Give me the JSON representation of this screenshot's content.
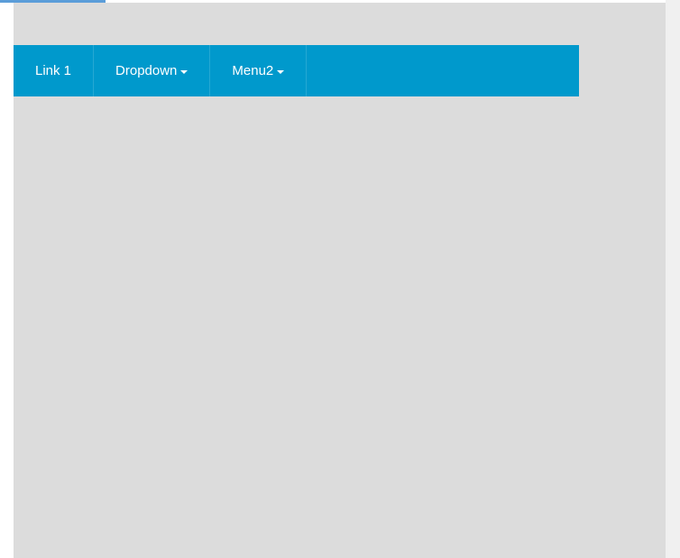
{
  "colors": {
    "navbar_bg": "#0099cc",
    "page_bg": "#dcdcdc",
    "text": "#ffffff",
    "indicator": "#5b9dd9"
  },
  "navbar": {
    "items": [
      {
        "label": "Link 1",
        "has_dropdown": false
      },
      {
        "label": "Dropdown",
        "has_dropdown": true
      },
      {
        "label": "Menu2",
        "has_dropdown": true
      }
    ]
  }
}
